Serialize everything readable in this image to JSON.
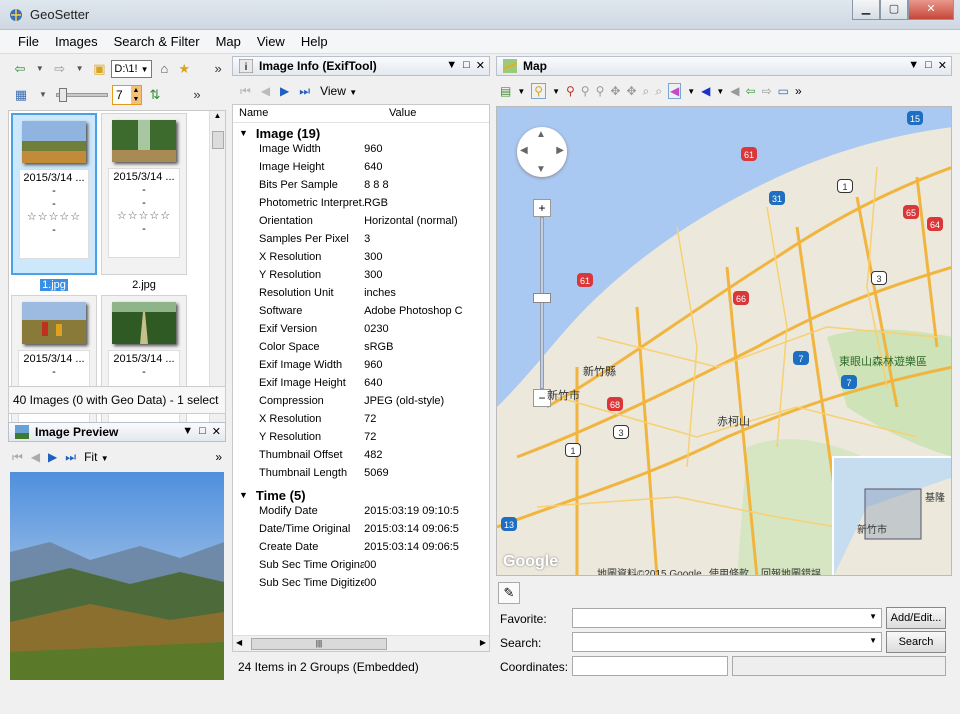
{
  "window": {
    "title": "GeoSetter",
    "buttons": {
      "minimize": "▁",
      "maximize": "▢",
      "close": "✕"
    }
  },
  "menu": [
    "File",
    "Images",
    "Search & Filter",
    "Map",
    "View",
    "Help"
  ],
  "left": {
    "drive": "D:\\1!",
    "number_value": "7",
    "thumbnails": [
      {
        "date": "2015/3/14 ...",
        "lines": [
          "-",
          "-"
        ],
        "stars": "☆☆☆☆☆",
        "after": "-",
        "name": "1.jpg",
        "selected": true
      },
      {
        "date": "2015/3/14 ...",
        "lines": [
          "-",
          "-"
        ],
        "stars": "☆☆☆☆☆",
        "after": "-",
        "name": "2.jpg",
        "selected": false
      },
      {
        "date": "2015/3/14 ...",
        "lines": [
          "-"
        ],
        "stars": "",
        "after": "",
        "name": "",
        "selected": false
      },
      {
        "date": "2015/3/14 ...",
        "lines": [
          "-"
        ],
        "stars": "",
        "after": "",
        "name": "",
        "selected": false
      }
    ],
    "status": "40 Images (0 with Geo Data) - 1 select",
    "preview": {
      "title": "Image Preview",
      "fit_label": "Fit"
    }
  },
  "middle": {
    "title": "Image Info (ExifTool)",
    "view_label": "View",
    "columns": {
      "name": "Name",
      "value": "Value"
    },
    "groups": [
      {
        "title": "Image (19)",
        "rows": [
          {
            "name": "Image Width",
            "value": "960"
          },
          {
            "name": "Image Height",
            "value": "640"
          },
          {
            "name": "Bits Per Sample",
            "value": "8 8 8"
          },
          {
            "name": "Photometric Interpret...",
            "value": "RGB"
          },
          {
            "name": "Orientation",
            "value": "Horizontal (normal)"
          },
          {
            "name": "Samples Per Pixel",
            "value": "3"
          },
          {
            "name": "X Resolution",
            "value": "300"
          },
          {
            "name": "Y Resolution",
            "value": "300"
          },
          {
            "name": "Resolution Unit",
            "value": "inches"
          },
          {
            "name": "Software",
            "value": "Adobe Photoshop C"
          },
          {
            "name": "Exif Version",
            "value": "0230"
          },
          {
            "name": "Color Space",
            "value": "sRGB"
          },
          {
            "name": "Exif Image Width",
            "value": "960"
          },
          {
            "name": "Exif Image Height",
            "value": "640"
          },
          {
            "name": "Compression",
            "value": "JPEG (old-style)"
          },
          {
            "name": "X Resolution",
            "value": "72"
          },
          {
            "name": "Y Resolution",
            "value": "72"
          },
          {
            "name": "Thumbnail Offset",
            "value": "482"
          },
          {
            "name": "Thumbnail Length",
            "value": "5069"
          }
        ]
      },
      {
        "title": "Time (5)",
        "rows": [
          {
            "name": "Modify Date",
            "value": "2015:03:19 09:10:5"
          },
          {
            "name": "Date/Time Original",
            "value": "2015:03:14 09:06:5"
          },
          {
            "name": "Create Date",
            "value": "2015:03:14 09:06:5"
          },
          {
            "name": "Sub Sec Time Original",
            "value": "00"
          },
          {
            "name": "Sub Sec Time Digitized",
            "value": "00"
          }
        ]
      }
    ],
    "status": "24 Items in 2 Groups   (Embedded)"
  },
  "map": {
    "title": "Map",
    "labels": {
      "county": "新竹縣",
      "city": "新竹市",
      "mountain": "赤柯山",
      "park": "東眼山森林遊樂區",
      "google": "Google",
      "attribution": "地圖資料©2015 Google",
      "terms": "使用條款",
      "report": "回報地圖錯誤",
      "mini_city": "新竹市",
      "mini_label": "基隆"
    },
    "route_shields": [
      "15",
      "61",
      "31",
      "1",
      "65",
      "64",
      "61",
      "66",
      "3",
      "7",
      "7",
      "68",
      "3",
      "1",
      "13"
    ],
    "form": {
      "favorite_label": "Favorite:",
      "search_label": "Search:",
      "coords_label": "Coordinates:",
      "add_edit_label": "Add/Edit...",
      "search_button": "Search"
    }
  }
}
